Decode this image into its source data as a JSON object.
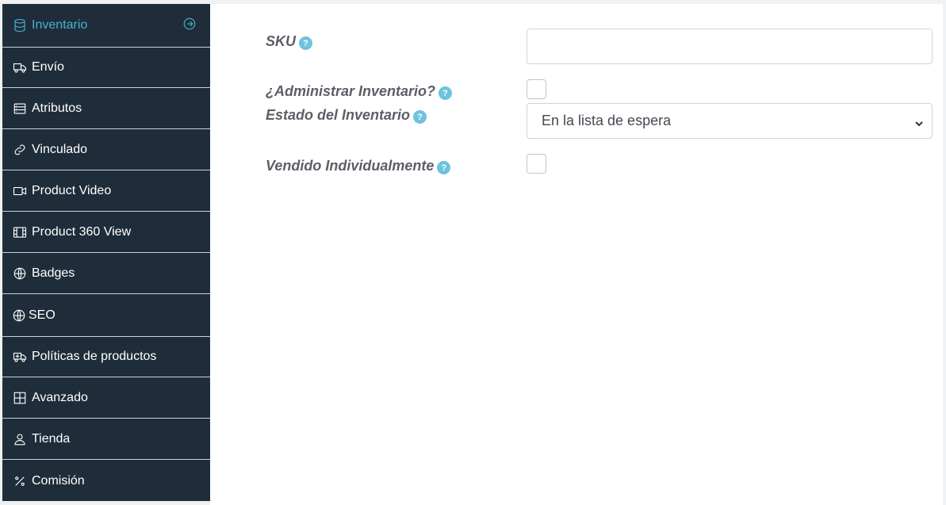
{
  "sidebar": {
    "items": [
      {
        "label": "Inventario",
        "icon": "database-icon",
        "active": true
      },
      {
        "label": "Envío",
        "icon": "truck-icon"
      },
      {
        "label": "Atributos",
        "icon": "server-icon"
      },
      {
        "label": "Vinculado",
        "icon": "link-icon"
      },
      {
        "label": "Product Video",
        "icon": "video-camera-icon"
      },
      {
        "label": "Product 360 View",
        "icon": "film-icon"
      },
      {
        "label": "Badges",
        "icon": "globe-icon"
      },
      {
        "label": "SEO",
        "icon": "globe-icon"
      },
      {
        "label": "Políticas de productos",
        "icon": "truck-plus-icon"
      },
      {
        "label": "Avanzado",
        "icon": "grid-icon"
      },
      {
        "label": "Tienda",
        "icon": "user-icon"
      },
      {
        "label": "Comisión",
        "icon": "percent-icon"
      }
    ],
    "accent_color": "#4ab3cd",
    "background_color": "#1f2d3a"
  },
  "form": {
    "sku": {
      "label": "SKU",
      "value": ""
    },
    "manage_stock": {
      "label": "¿Administrar Inventario?",
      "checked": false
    },
    "stock_status": {
      "label": "Estado del Inventario",
      "value": "En la lista de espera"
    },
    "sold_individually": {
      "label": "Vendido Individualmente",
      "checked": false
    },
    "help_glyph": "?"
  }
}
